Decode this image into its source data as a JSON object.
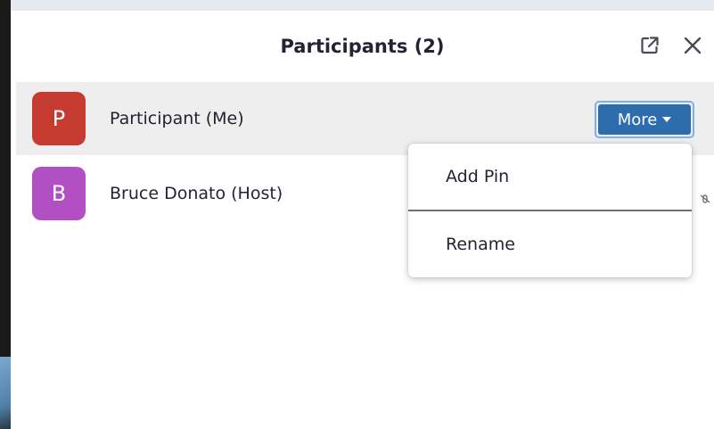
{
  "panel": {
    "title": "Participants (2)",
    "popout_icon": "popout-icon",
    "close_icon": "close-icon"
  },
  "participants": [
    {
      "initial": "P",
      "name": "Participant (Me)",
      "avatar_color": "#c63b2f"
    },
    {
      "initial": "B",
      "name": "Bruce Donato (Host)",
      "avatar_color": "#b24fc3"
    }
  ],
  "more_button": {
    "label": "More",
    "color": "#2d6dad"
  },
  "dropdown": {
    "items": [
      {
        "label": "Add Pin"
      },
      {
        "label": "Rename"
      }
    ]
  }
}
